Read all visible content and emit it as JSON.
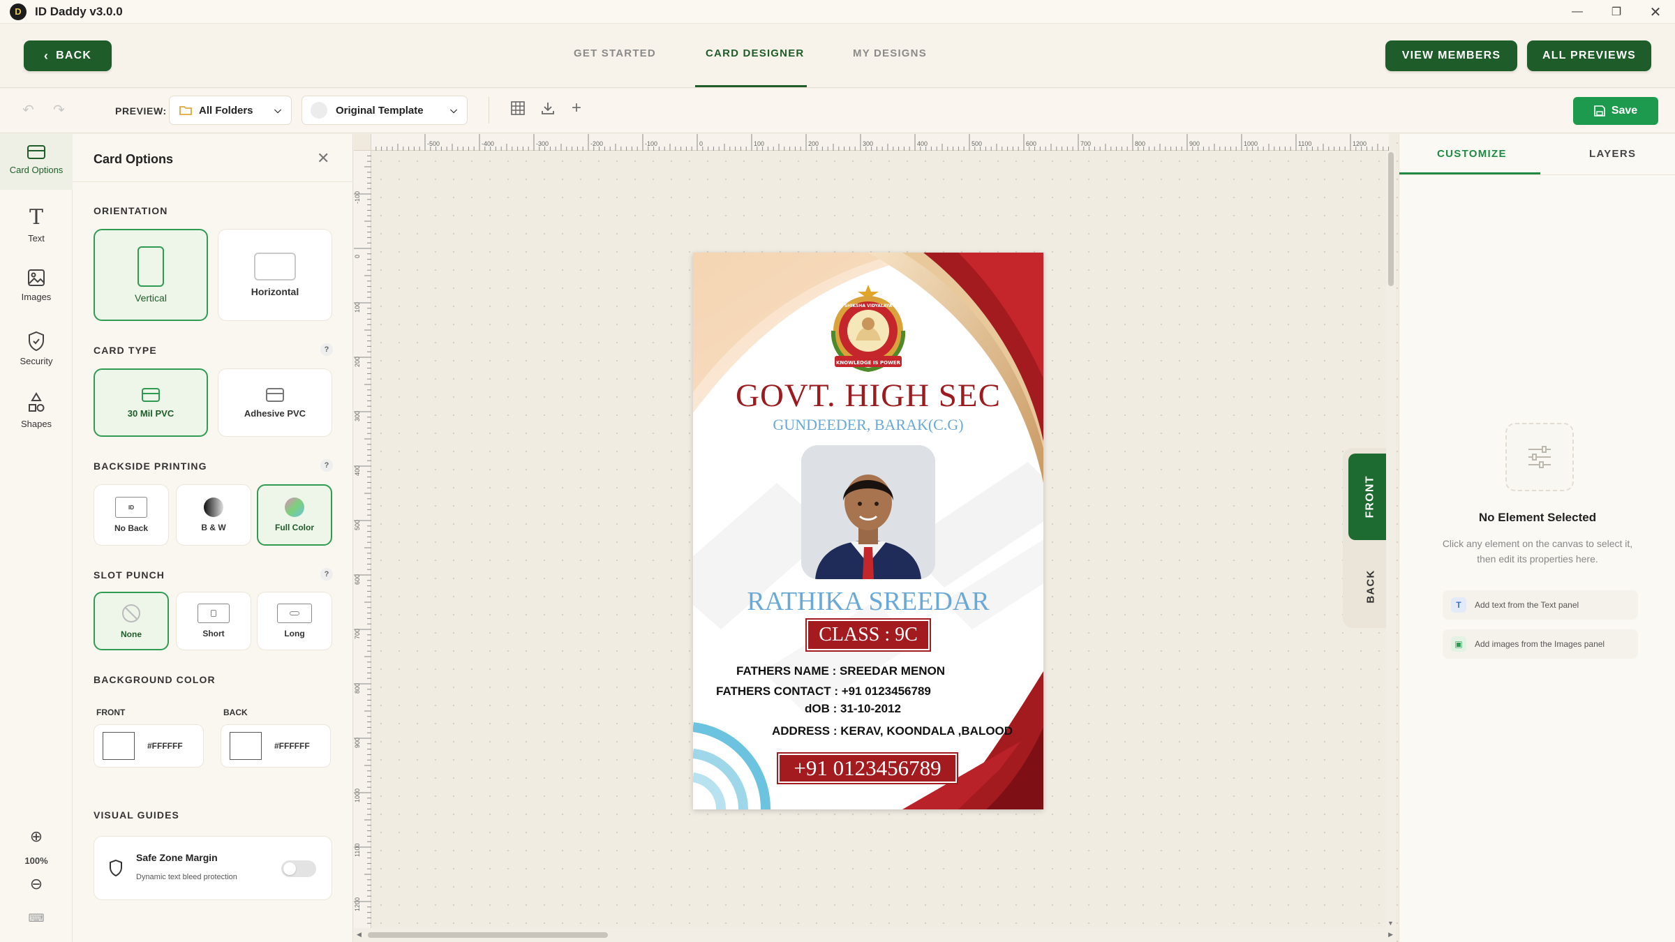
{
  "app": {
    "title": "ID Daddy v3.0.0"
  },
  "nav": {
    "back_label": "BACK",
    "tabs": [
      {
        "label": "GET STARTED"
      },
      {
        "label": "CARD DESIGNER"
      },
      {
        "label": "MY DESIGNS"
      }
    ],
    "view_members_label": "VIEW MEMBERS",
    "all_previews_label": "ALL PREVIEWS"
  },
  "toolbar": {
    "preview_label": "PREVIEW:",
    "folder_value": "All Folders",
    "template_value": "Original Template",
    "save_label": "Save"
  },
  "rail": {
    "items": [
      {
        "label": "Card Options",
        "icon": "card-icon"
      },
      {
        "label": "Text",
        "icon": "text-icon"
      },
      {
        "label": "Images",
        "icon": "image-icon"
      },
      {
        "label": "Security",
        "icon": "shield-icon"
      },
      {
        "label": "Shapes",
        "icon": "shapes-icon"
      }
    ],
    "zoom_level": "100%"
  },
  "panel": {
    "title": "Card Options",
    "orientation": {
      "label": "ORIENTATION",
      "options": [
        "Vertical",
        "Horizontal"
      ],
      "selected": "Vertical"
    },
    "card_type": {
      "label": "CARD TYPE",
      "options": [
        "30 Mil PVC",
        "Adhesive PVC"
      ],
      "selected": "30 Mil PVC"
    },
    "backside": {
      "label": "BACKSIDE PRINTING",
      "options": [
        "No Back",
        "B & W",
        "Full Color"
      ],
      "selected": "Full Color",
      "no_back_icon_text": "ID"
    },
    "slot_punch": {
      "label": "SLOT PUNCH",
      "options": [
        "None",
        "Short",
        "Long"
      ],
      "selected": "None"
    },
    "background": {
      "label": "BACKGROUND COLOR",
      "front_label": "FRONT",
      "back_label": "BACK",
      "front_hex": "#FFFFFF",
      "back_hex": "#FFFFFF"
    },
    "guides": {
      "label": "VISUAL GUIDES",
      "title": "Safe Zone Margin",
      "subtitle": "Dynamic text bleed protection",
      "enabled": false
    },
    "help_glyph": "?"
  },
  "rulers": {
    "top_ticks": [
      "-500",
      "-400",
      "-300",
      "-200",
      "-100",
      "0",
      "100",
      "200",
      "300",
      "400",
      "500",
      "600",
      "700",
      "800",
      "900",
      "1000",
      "1100",
      "1200"
    ],
    "left_ticks": [
      "-100",
      "0",
      "100",
      "200",
      "300",
      "400",
      "500",
      "600",
      "700",
      "800",
      "900",
      "1000",
      "1100",
      "1200"
    ]
  },
  "card": {
    "emblem_ribbon": "KNOWLEDGE IS POWER",
    "emblem_ring_text": "SHIKSHA VIDYALAYA",
    "school_name": "GOVT. HIGH SEC",
    "school_location": "GUNDEEDER, BARAK(C.G)",
    "student_name": "RATHIKA SREEDAR",
    "class_text": "CLASS :  9C",
    "fathers_name": "FATHERS NAME : SREEDAR MENON",
    "fathers_contact": "FATHERS CONTACT : +91 0123456789",
    "dob": "dOB :  31-10-2012",
    "address": "ADDRESS :  KERAV, KOONDALA ,BALOOD",
    "phone": "+91 0123456789",
    "colors": {
      "primary_red": "#a31a1f",
      "title_red": "#9b1b1f",
      "accent_blue": "#6cc3e0",
      "name_blue": "#6aa9d6",
      "gold": "#d9b07a"
    }
  },
  "side_toggle": {
    "front_label": "FRONT",
    "back_label": "BACK"
  },
  "right_panel": {
    "tabs": [
      "CUSTOMIZE",
      "LAYERS"
    ],
    "empty_title": "No Element Selected",
    "empty_desc": "Click any element on the canvas to select it, then edit its properties here.",
    "hints": [
      "Add text from the Text panel",
      "Add images from the Images panel"
    ]
  },
  "theme": {
    "brand_green": "#1e5c2a",
    "save_green": "#1d9a4d",
    "select_green": "#2f9b52"
  }
}
